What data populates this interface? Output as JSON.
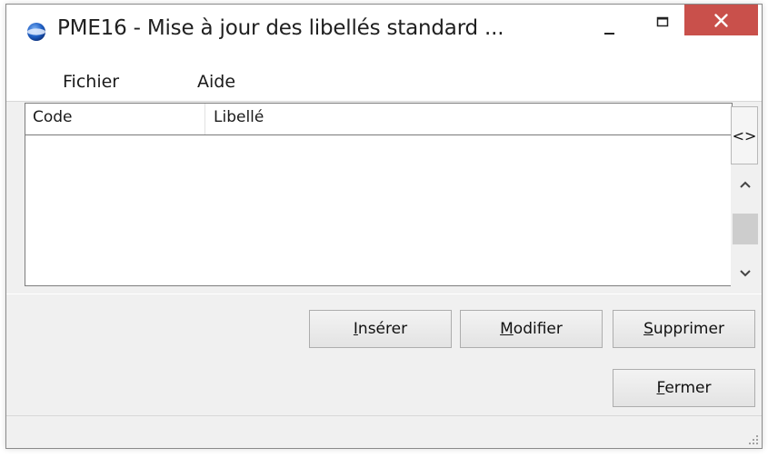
{
  "window": {
    "title": "PME16 - Mise à jour des libellés standard ...",
    "icon": "globe-icon",
    "close_color": "#c9504b"
  },
  "menu": {
    "items": [
      {
        "label": "Fichier"
      },
      {
        "label": "Aide"
      }
    ]
  },
  "table": {
    "columns": [
      "Code",
      "Libellé"
    ],
    "rows": [],
    "swap_label": "<>"
  },
  "buttons": {
    "inserer": {
      "accel": "I",
      "rest": "nsérer"
    },
    "modifier": {
      "accel": "M",
      "rest": "odifier"
    },
    "supprimer": {
      "accel": "S",
      "rest": "upprimer"
    },
    "fermer": {
      "accel": "F",
      "rest": "ermer"
    }
  }
}
